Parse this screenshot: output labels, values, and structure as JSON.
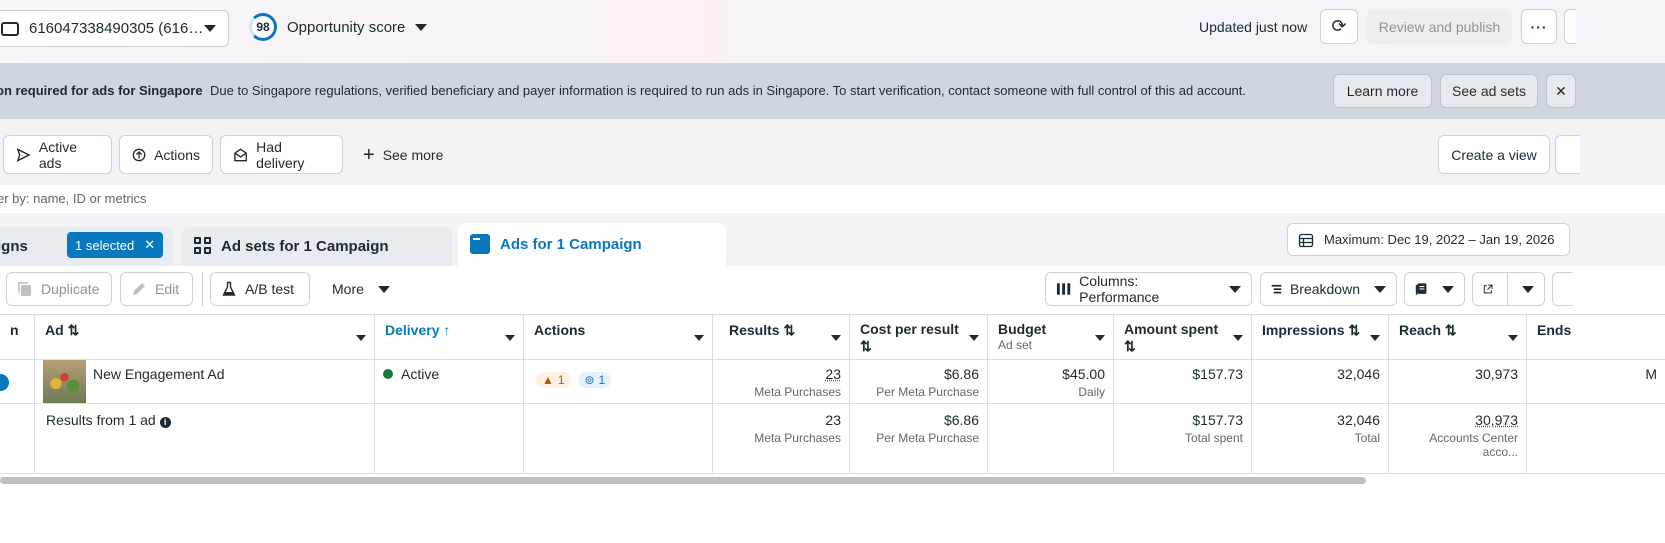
{
  "topbar": {
    "account_label": "616047338490305 (616…",
    "opportunity_score": "98",
    "opportunity_label": "Opportunity score",
    "updated": "Updated just now",
    "review_label": "Review and publish",
    "more_label": "···"
  },
  "banner": {
    "title": "on required for ads for Singapore",
    "message": "Due to Singapore regulations, verified beneficiary and payer information is required to run ads in Singapore. To start verification, contact someone with full control of this ad account.",
    "learn_more": "Learn more",
    "see_ad_sets": "See ad sets",
    "close": "✕"
  },
  "filters": {
    "active_ads": "Active ads",
    "actions": "Actions",
    "had_delivery": "Had delivery",
    "see_more": "See more",
    "create_view": "Create a view"
  },
  "search": {
    "placeholder": "er by: name, ID or metrics"
  },
  "tabs": {
    "campaigns": "igns",
    "selected": "1 selected",
    "adsets": "Ad sets for 1 Campaign",
    "ads": "Ads for 1 Campaign",
    "date_range": "Maximum: Dec 19, 2022 – Jan 19, 2026"
  },
  "toolbar": {
    "duplicate": "Duplicate",
    "edit": "Edit",
    "ab_test": "A/B test",
    "more": "More",
    "columns": "Columns: Performance",
    "breakdown": "Breakdown"
  },
  "table": {
    "headers": {
      "ad": "Ad",
      "delivery": "Delivery",
      "actions": "Actions",
      "results": "Results",
      "cost_per_result": "Cost per result",
      "budget": "Budget",
      "budget_sub": "Ad set",
      "amount_spent": "Amount spent",
      "impressions": "Impressions",
      "reach": "Reach",
      "ends": "Ends"
    },
    "row": {
      "ad_name": "New Engagement Ad",
      "delivery": "Active",
      "warn_count": "1",
      "action_count": "1",
      "results": "23",
      "results_sub": "Meta Purchases",
      "cost": "$6.86",
      "cost_sub": "Per Meta Purchase",
      "budget": "$45.00",
      "budget_sub": "Daily",
      "spent": "$157.73",
      "impressions": "32,046",
      "reach": "30,973",
      "ends": "M"
    },
    "summary": {
      "label": "Results from 1 ad",
      "results": "23",
      "results_sub": "Meta Purchases",
      "cost": "$6.86",
      "cost_sub": "Per Meta Purchase",
      "spent": "$157.73",
      "spent_sub": "Total spent",
      "impressions": "32,046",
      "impressions_sub": "Total",
      "reach": "30,973",
      "reach_sub": "Accounts Center acco..."
    }
  }
}
